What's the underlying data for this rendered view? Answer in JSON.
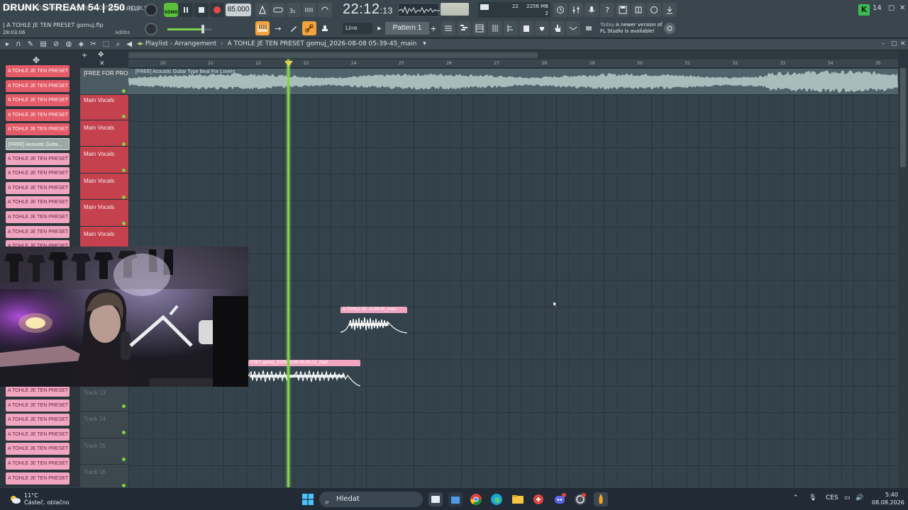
{
  "window": {
    "stream_title": "DRUNK STREAM 54 | 250",
    "menu_text": "FILE EDIT ADD PATTERNS VIEW OPTIONS TOOLS",
    "help_label": "HELP",
    "project_line": "| A TOHLE JE TEN PRESET gomuj.flp",
    "project_time": "28:03:06",
    "adlibs_label": "Adlibs"
  },
  "transport": {
    "song_label": "SONG",
    "tempo": "85.000",
    "time_main": "22:12",
    "time_sub": ":13",
    "cpu_value": "22",
    "memory": "2256 MB",
    "polyphony": "2",
    "snap": "Line",
    "pattern": "Pattern 1"
  },
  "news": {
    "today": "Today",
    "line1": "A newer version of",
    "line2": "FL Studio is available!"
  },
  "playlist": {
    "label": "Playlist - Arrangement",
    "separator": "›",
    "name": "A TOHLE JE TEN PRESET gomuj_2026-08-08 05-39-45_main"
  },
  "ruler": {
    "bars": [
      "20",
      "21",
      "22",
      "23",
      "24",
      "25",
      "26",
      "27",
      "28",
      "29",
      "30",
      "31",
      "32",
      "33",
      "34",
      "35"
    ]
  },
  "pattern_picker": {
    "top_items": [
      {
        "label": "A TOHLE JE TEN PRESET g...",
        "style": "red"
      },
      {
        "label": "A TOHLE JE TEN PRESET g...",
        "style": "red"
      },
      {
        "label": "A TOHLE JE TEN PRESET g...",
        "style": "red"
      },
      {
        "label": "A TOHLE JE TEN PRESET g...",
        "style": "red"
      },
      {
        "label": "A TOHLE JE TEN PRESET g...",
        "style": "red"
      },
      {
        "label": "[FREE] Acoustic Guita...",
        "style": "audio"
      },
      {
        "label": "A TOHLE JE TEN PRESET g...",
        "style": "pink"
      },
      {
        "label": "A TOHLE JE TEN PRESET g...",
        "style": "pink"
      },
      {
        "label": "A TOHLE JE TEN PRESET g...",
        "style": "pink"
      },
      {
        "label": "A TOHLE JE TEN PRESET g...",
        "style": "pink"
      },
      {
        "label": "A TOHLE JE TEN PRESET g...",
        "style": "pink"
      },
      {
        "label": "A TOHLE JE TEN PRESET g...",
        "style": "pink"
      },
      {
        "label": "A TOHLE JE TEN PRESET g...",
        "style": "pink"
      },
      {
        "label": "A TOHLE JE TEN PRESET g...",
        "style": "pink"
      }
    ],
    "bottom_items": [
      {
        "label": "A TOHLE JE TEN PRESET g...",
        "style": "pink"
      },
      {
        "label": "A TOHLE JE TEN PRESET g...",
        "style": "pink"
      },
      {
        "label": "A TOHLE JE TEN PRESET g...",
        "style": "pink"
      },
      {
        "label": "A TOHLE JE TEN PRESET g...",
        "style": "pink"
      },
      {
        "label": "A TOHLE JE TEN PRESET g...",
        "style": "pink"
      },
      {
        "label": "A TOHLE JE TEN PRESET g...",
        "style": "pink"
      },
      {
        "label": "A TOHLE JE TEN PRESET g...",
        "style": "pink"
      }
    ]
  },
  "tracks": {
    "audio_track_name": "[FREE FOR PROF...",
    "audio_clip_name": "[FREE] Acoustic Guitar Type Beat For Lovers",
    "vocal_header_name": "Main Vocals",
    "vocal_tracks": [
      "Main Vocals",
      "Main Vocals",
      "Main Vocals",
      "Main Vocals",
      "Main Vocals"
    ],
    "lower_tracks": [
      "Track 13",
      "Track 14",
      "Track 15",
      "Track 16"
    ]
  },
  "clips": {
    "clip_a": "A TOHLE JE...5-39-45_main",
    "clip_b": "ESET gomuj_2026-08-08 05-39-12_main"
  },
  "taskbar": {
    "temperature": "11°C",
    "weather": "Částeč. oblačno",
    "search_placeholder": "Hledat",
    "language": "CES",
    "time": "5:40",
    "date": "08.08.2026"
  },
  "colors": {
    "accent_green": "#7ed24a",
    "vocal_track_red": "#c4414d",
    "pattern_pink": "#f0a6c0",
    "grid_bg": "#34434b"
  }
}
